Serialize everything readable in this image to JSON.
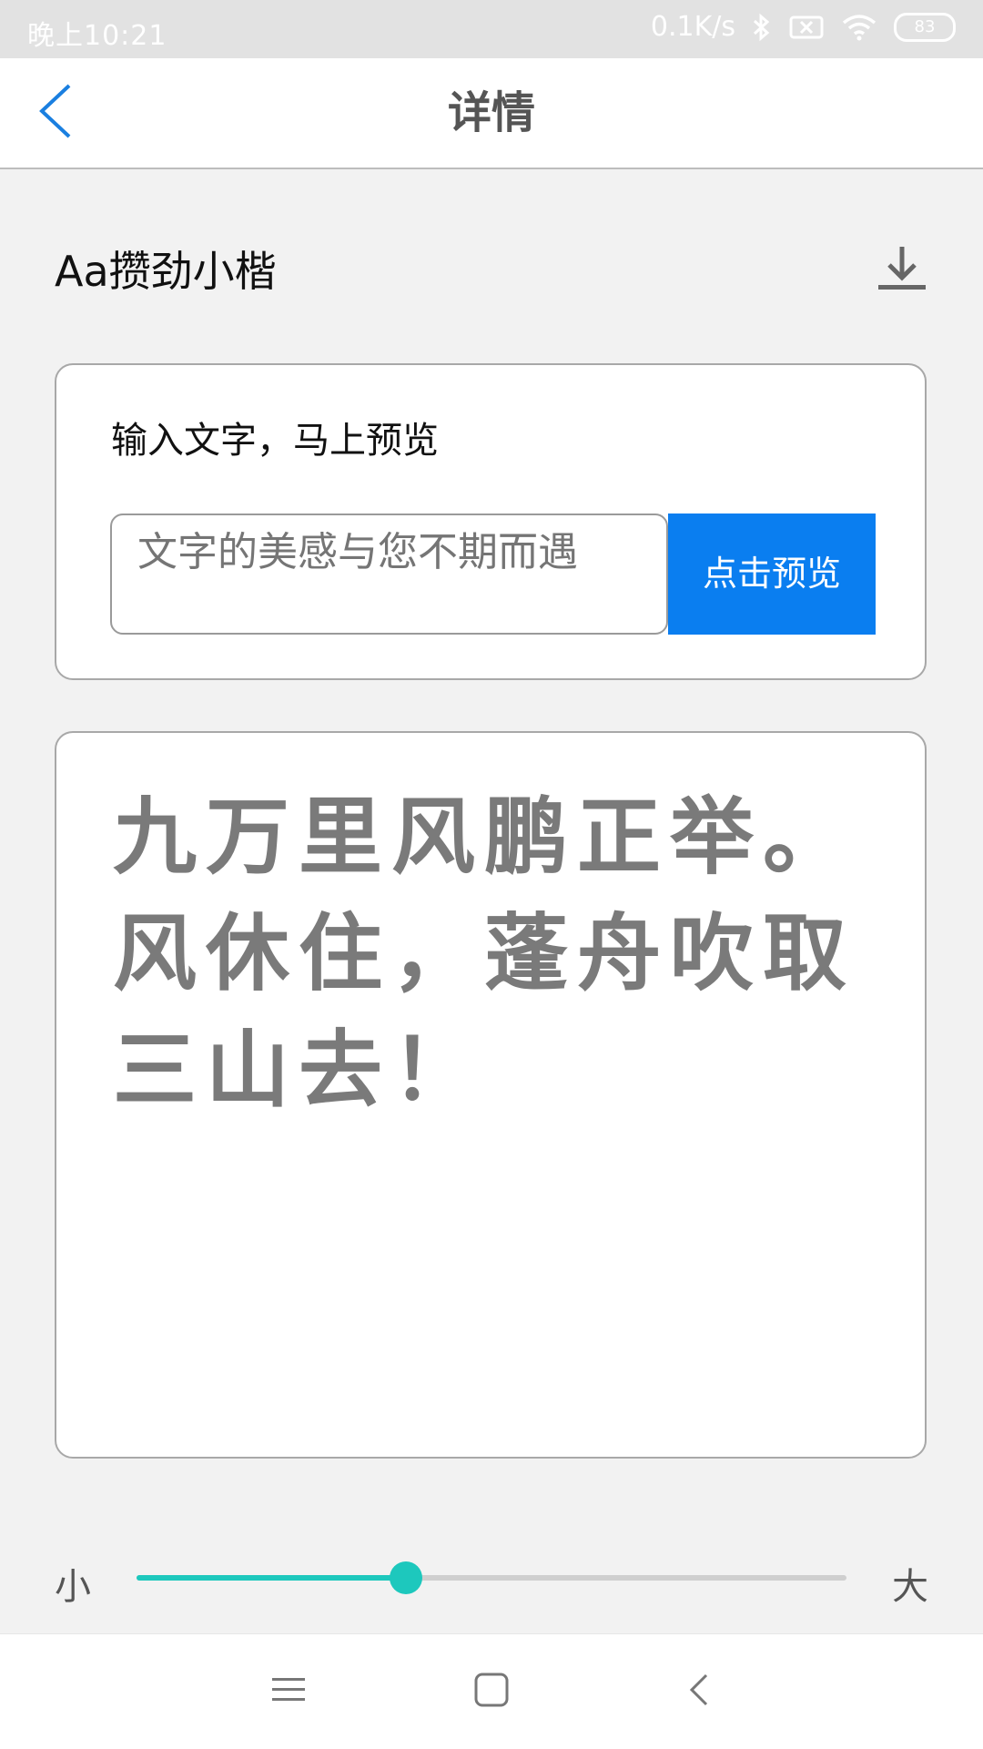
{
  "status_bar": {
    "time": "晚上10:21",
    "net_speed": "0.1K/s",
    "battery": "83",
    "icons": [
      "bluetooth-icon",
      "sim-off-icon",
      "wifi-icon",
      "battery-icon"
    ]
  },
  "header": {
    "title": "详情",
    "back_icon": "chevron-left-icon"
  },
  "font": {
    "name": "Aa攒劲小楷",
    "download_icon": "download-icon"
  },
  "input_card": {
    "label": "输入文字，马上预览",
    "placeholder": "文字的美感与您不期而遇",
    "button_label": "点击预览"
  },
  "preview": {
    "text": "九万里风鹏正举。风休住，蓬舟吹取三山去！"
  },
  "size_slider": {
    "min_label": "小",
    "max_label": "大",
    "value": 0.38
  },
  "nav_bar": {
    "icons": [
      "menu-icon",
      "home-icon",
      "back-icon"
    ]
  },
  "colors": {
    "accent": "#0a7ef0",
    "slider": "#1dc8bd",
    "back_icon": "#1a7fe0"
  }
}
